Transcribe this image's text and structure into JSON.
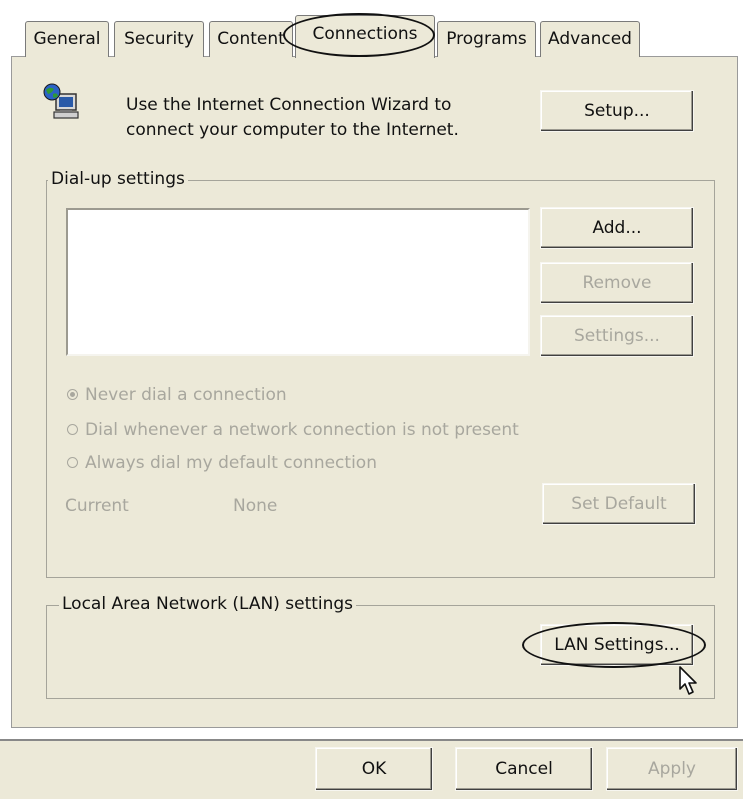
{
  "tabs": [
    {
      "label": "General"
    },
    {
      "label": "Security"
    },
    {
      "label": "Content"
    },
    {
      "label": "Connections"
    },
    {
      "label": "Programs"
    },
    {
      "label": "Advanced"
    }
  ],
  "wizard": {
    "text_line1": "Use the Internet Connection Wizard to",
    "text_line2": "connect your computer to the Internet.",
    "setup_label": "Setup..."
  },
  "dialup": {
    "group_label": "Dial-up settings",
    "add_label": "Add...",
    "remove_label": "Remove",
    "settings_label": "Settings...",
    "options": [
      {
        "label": "Never dial a connection",
        "checked": true
      },
      {
        "label": "Dial whenever a network connection is not present",
        "checked": false
      },
      {
        "label": "Always dial my default connection",
        "checked": false
      }
    ],
    "current_label": "Current",
    "current_value": "None",
    "set_default_label": "Set Default"
  },
  "lan": {
    "group_label": "Local Area Network (LAN) settings",
    "lan_settings_label": "LAN Settings..."
  },
  "footer": {
    "ok_label": "OK",
    "cancel_label": "Cancel",
    "apply_label": "Apply"
  },
  "icons": {
    "wizard_icon": "computer-globe-icon",
    "cursor_icon": "mouse-pointer-icon"
  },
  "colors": {
    "dialog_bg": "#ece9d8",
    "disabled_text": "#a8a79e",
    "annotation": "#111111"
  }
}
